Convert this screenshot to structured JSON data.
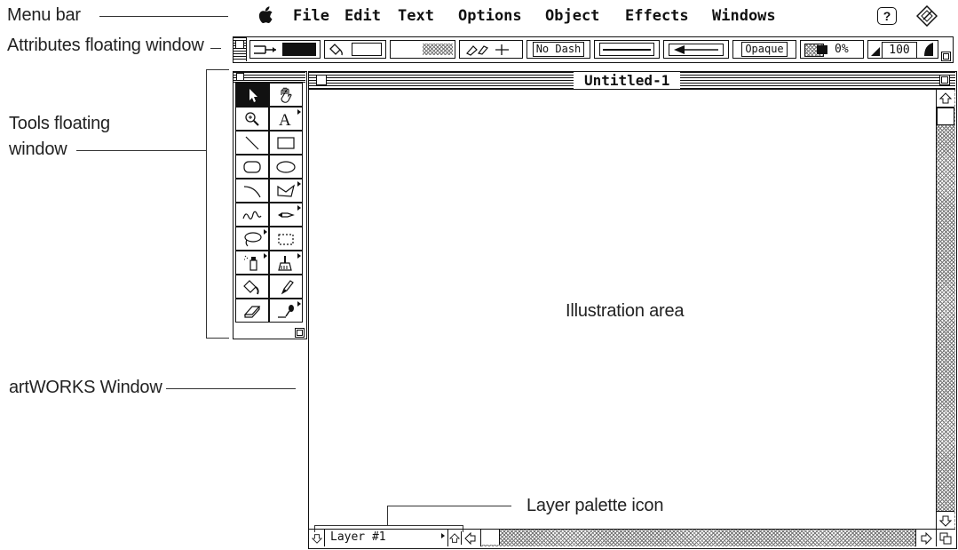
{
  "callouts": {
    "menu_bar": "Menu bar",
    "attributes_window": "Attributes floating window",
    "tools_window_line1": "Tools floating",
    "tools_window_line2": "window",
    "artworks_window": "artWORKS Window",
    "illustration_area": "Illustration area",
    "layer_palette_icon": "Layer palette icon"
  },
  "menu": {
    "apple_glyph": "",
    "items": [
      "File",
      "Edit",
      "Text",
      "Options",
      "Object",
      "Effects",
      "Windows"
    ],
    "help_label": "?"
  },
  "attributes_bar": {
    "dash_label": "No Dash",
    "opacity_label": "Opaque",
    "transparency_value": "0%",
    "zoom_value": "100"
  },
  "window": {
    "title": "Untitled-1"
  },
  "layer_bar": {
    "layer_name": "Layer #1"
  },
  "icons": [
    "apple-icon",
    "help-icon",
    "artworks-app-icon",
    "arrow-tool-icon",
    "hand-tool-icon",
    "zoom-tool-icon",
    "text-tool-icon",
    "line-tool-icon",
    "rectangle-tool-icon",
    "rounded-rect-tool-icon",
    "ellipse-tool-icon",
    "arc-tool-icon",
    "polygon-tool-icon",
    "freehand-tool-icon",
    "pen-tool-icon",
    "lasso-tool-icon",
    "marquee-tool-icon",
    "spray-tool-icon",
    "brush-tool-icon",
    "paint-bucket-tool-icon",
    "pencil-tool-icon",
    "eraser-tool-icon",
    "eyedropper-tool-icon"
  ]
}
